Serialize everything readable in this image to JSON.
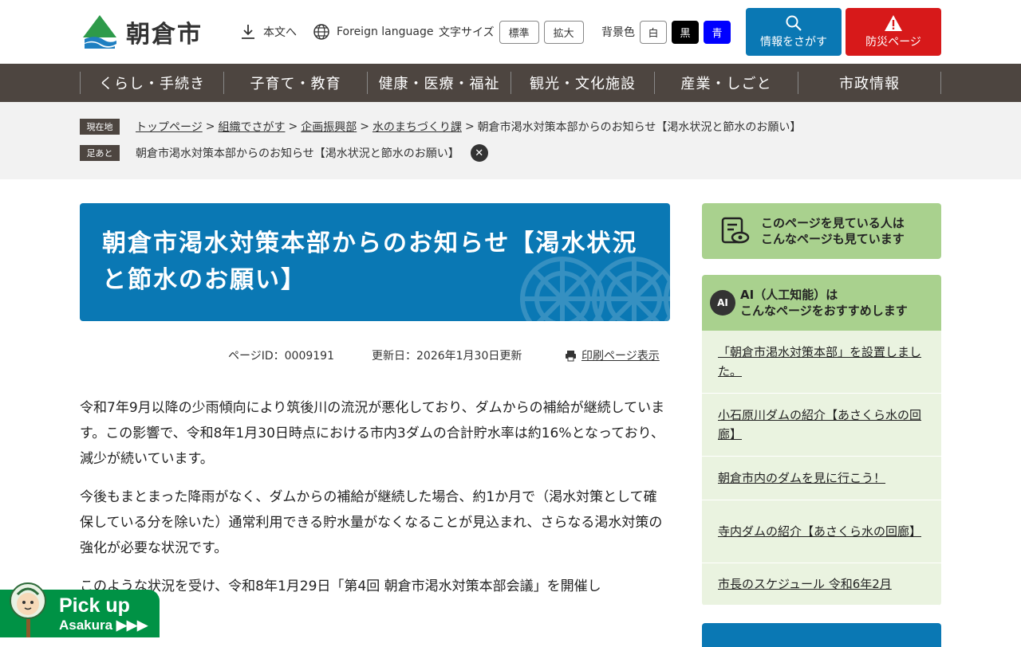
{
  "header": {
    "logo_text": "朝倉市",
    "skip_label": "本文へ",
    "language_label": "Foreign language",
    "text_size_label": "文字サイズ",
    "text_size_options": [
      "標準",
      "拡大"
    ],
    "bg_color_label": "背景色",
    "bg_color_options": [
      "白",
      "黒",
      "青"
    ],
    "search_label": "情報をさがす",
    "disaster_label": "防災ページ"
  },
  "nav": {
    "items": [
      "くらし・手続き",
      "子育て・教育",
      "健康・医療・福祉",
      "観光・文化施設",
      "産業・しごと",
      "市政情報"
    ]
  },
  "breadcrumb": {
    "current_tag": "現在地",
    "trail": [
      "トップページ",
      "組織でさがす",
      "企画振興部",
      "水のまちづくり課"
    ],
    "current": "朝倉市渇水対策本部からのお知らせ【渇水状況と節水のお願い】",
    "history_tag": "足あと",
    "history_item": "朝倉市渇水対策本部からのお知らせ【渇水状況と節水のお願い】",
    "sep": ">"
  },
  "page": {
    "title": "朝倉市渇水対策本部からのお知らせ【渇水状況と節水のお願い】",
    "page_id": "ページID：0009191",
    "updated": "更新日：2026年1月30日更新",
    "print_label": "印刷ページ表示",
    "paragraphs": [
      "令和7年9月以降の少雨傾向により筑後川の流況が悪化しており、ダムからの補給が継続しています。この影響で、令和8年1月30日時点における市内3ダムの合計貯水率は約16%となっており、減少が続いています。",
      "今後もまとまった降雨がなく、ダムからの補給が継続した場合、約1か月で（渇水対策として確保している分を除いた）通常利用できる貯水量がなくなることが見込まれ、さらなる渇水対策の強化が必要な状況です。",
      "このような状況を受け、令和8年1月29日「第4回 朝倉市渇水対策本部会議」を開催し"
    ]
  },
  "sidebar": {
    "related_heading": "このページを見ている人は\nこんなページも見ています",
    "ai_badge": "AI",
    "ai_heading": "AI（人工知能）は\nこんなページをおすすめします",
    "ai_items": [
      "「朝倉市渇水対策本部」を設置しました。",
      "小石原川ダムの紹介【あさくら水の回廊】",
      "朝倉市内のダムを見に行こう！",
      "寺内ダムの紹介【あさくら水の回廊】",
      "市長のスケジュール 令和6年2月"
    ]
  },
  "pickup": {
    "title": "Pick up",
    "subtitle": "Asakura ▶▶▶"
  },
  "colors": {
    "primary_blue": "#0a78b4",
    "disaster_red": "#d7191a",
    "nav_brown": "#4d4540",
    "side_green": "#a9d18e",
    "pickup_green": "#009245"
  },
  "icons": [
    "download-icon",
    "globe-icon",
    "search-icon",
    "warning-icon",
    "close-icon",
    "printer-icon",
    "document-eye-icon",
    "ai-head-icon"
  ]
}
